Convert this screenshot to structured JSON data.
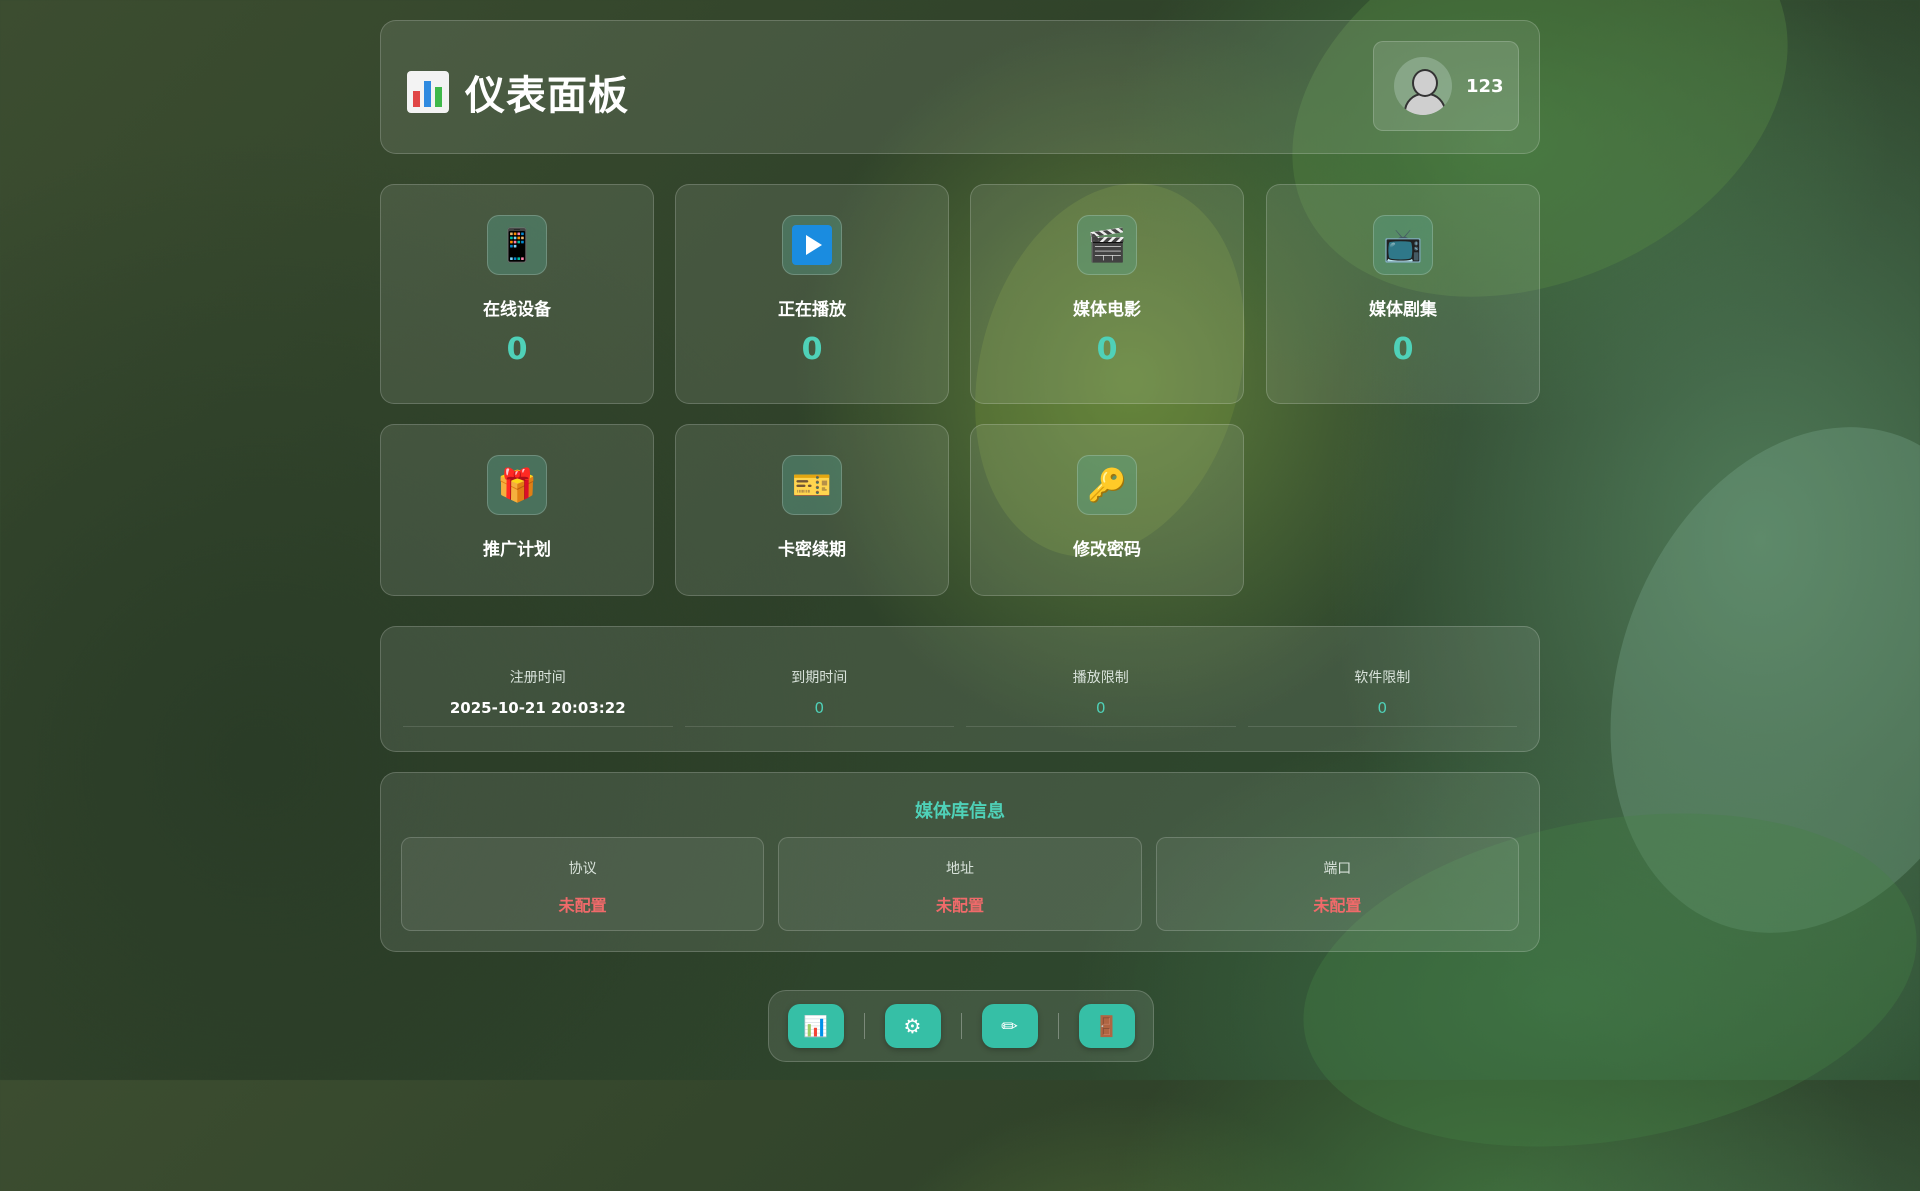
{
  "header": {
    "title": "仪表面板",
    "title_icon": "bar-chart-icon",
    "user": {
      "avatar_icon": "user-avatar-icon",
      "name": "123"
    }
  },
  "stats": [
    {
      "icon": "mobile-phone-icon",
      "glyph": "📱",
      "label": "在线设备",
      "value": "0"
    },
    {
      "icon": "play-button-icon",
      "glyph": "▶",
      "label": "正在播放",
      "value": "0"
    },
    {
      "icon": "clapperboard-icon",
      "glyph": "🎬",
      "label": "媒体电影",
      "value": "0"
    },
    {
      "icon": "television-icon",
      "glyph": "📺",
      "label": "媒体剧集",
      "value": "0"
    }
  ],
  "actions": [
    {
      "icon": "gift-icon",
      "glyph": "🎁",
      "label": "推广计划"
    },
    {
      "icon": "ticket-icon",
      "glyph": "🎫",
      "label": "卡密续期"
    },
    {
      "icon": "key-icon",
      "glyph": "🔑",
      "label": "修改密码"
    }
  ],
  "account_info": [
    {
      "label": "注册时间",
      "value": "2025-10-21 20:03:22"
    },
    {
      "label": "到期时间",
      "value": "0"
    },
    {
      "label": "播放限制",
      "value": "0"
    },
    {
      "label": "软件限制",
      "value": "0"
    }
  ],
  "library": {
    "title": "媒体库信息",
    "items": [
      {
        "label": "协议",
        "value": "未配置"
      },
      {
        "label": "地址",
        "value": "未配置"
      },
      {
        "label": "端口",
        "value": "未配置"
      }
    ]
  },
  "dock": [
    {
      "icon": "bar-chart-icon",
      "glyph": "📊"
    },
    {
      "icon": "gear-icon",
      "glyph": "⚙"
    },
    {
      "icon": "pencil-icon",
      "glyph": "✏"
    },
    {
      "icon": "door-icon",
      "glyph": "🚪"
    }
  ],
  "colors": {
    "accent": "#4fd1b8",
    "warning": "#f06a6a",
    "dock_button": "#36bfa6"
  }
}
